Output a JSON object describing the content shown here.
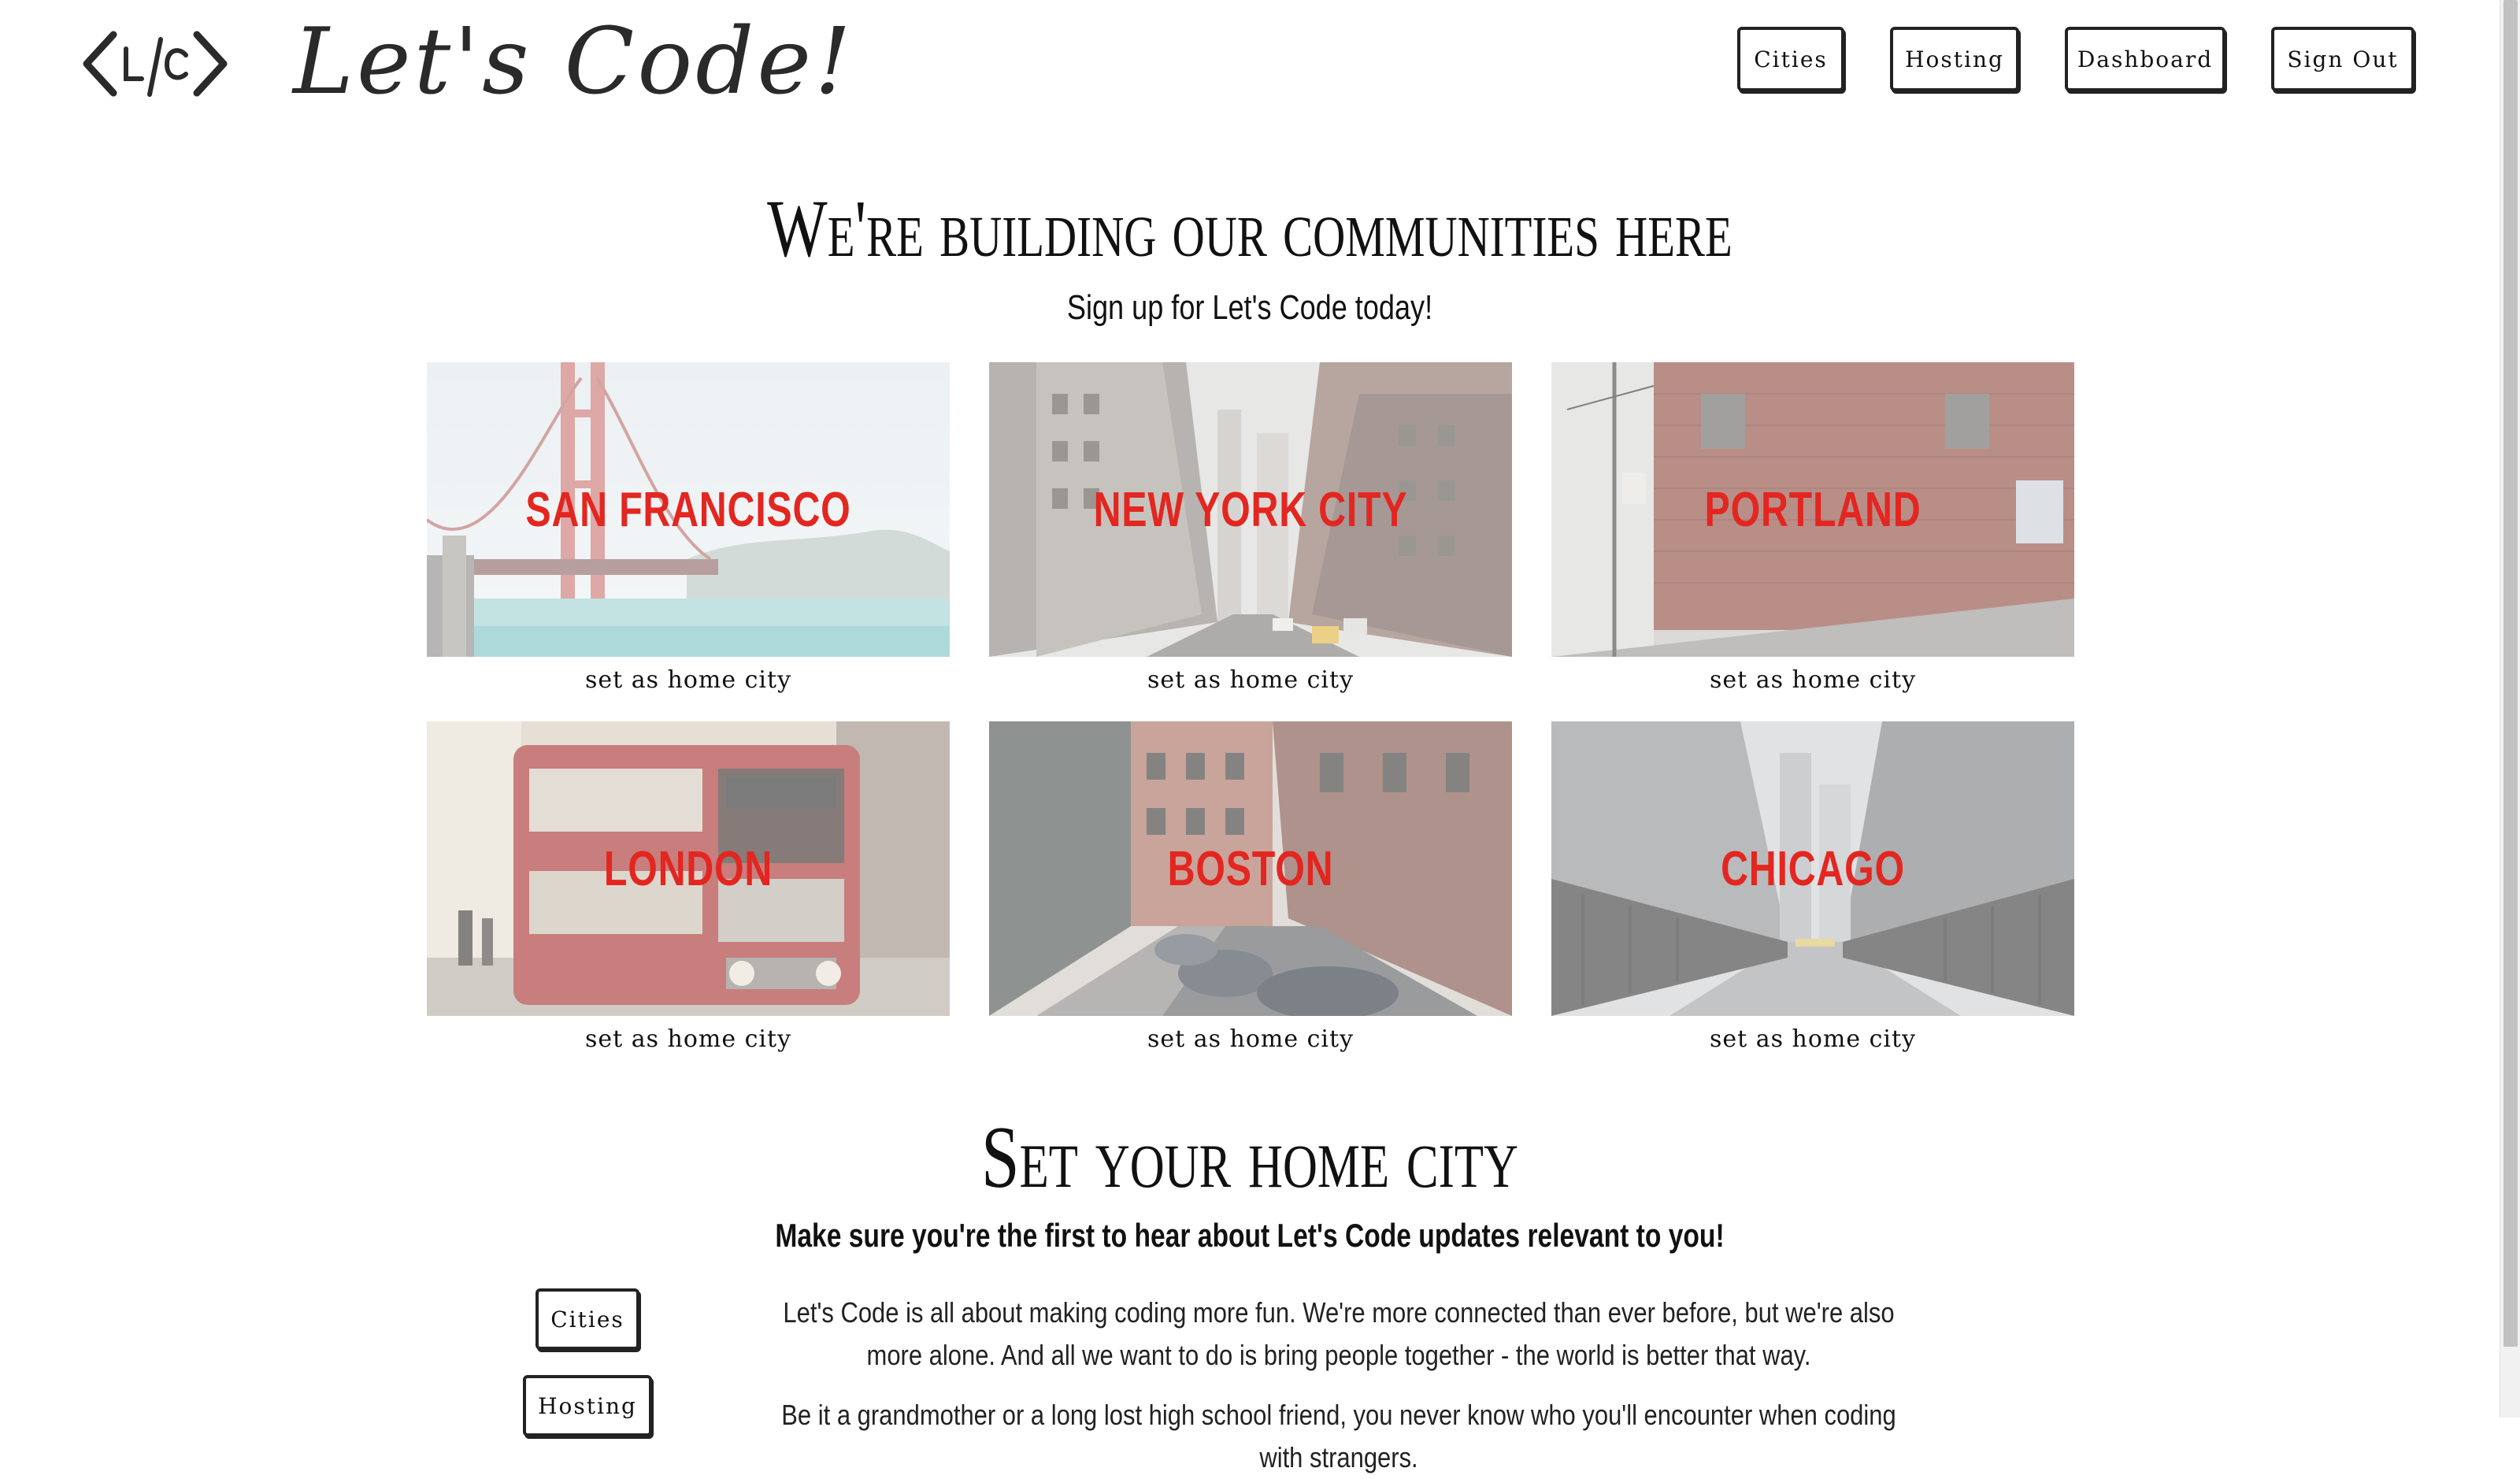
{
  "header": {
    "logo_text": "<L/C>",
    "brand": "Let's Code!",
    "nav": [
      {
        "label": "Cities"
      },
      {
        "label": "Hosting"
      },
      {
        "label": "Dashboard"
      },
      {
        "label": "Sign Out"
      }
    ]
  },
  "hero": {
    "title": "We're building our communities here",
    "subtitle": "Sign up for Let's Code today!"
  },
  "cities": [
    {
      "name": "SAN FRANCISCO",
      "action": "set as home city"
    },
    {
      "name": "NEW YORK CITY",
      "action": "set as home city"
    },
    {
      "name": "PORTLAND",
      "action": "set as home city"
    },
    {
      "name": "LONDON",
      "action": "set as home city"
    },
    {
      "name": "BOSTON",
      "action": "set as home city"
    },
    {
      "name": "CHICAGO",
      "action": "set as home city"
    }
  ],
  "home_section": {
    "title": "Set your home city",
    "subtitle": "Make sure you're the first to hear about Let's Code updates relevant to you!",
    "side_nav": [
      {
        "label": "Cities"
      },
      {
        "label": "Hosting"
      }
    ],
    "paragraphs": [
      "Let's Code is all about making coding more fun. We're more connected than ever before, but we're also more alone. And all we want to do is bring people together - the world is better that way.",
      "Be it a grandmother or a long lost high school friend, you never know who you'll encounter when coding with strangers."
    ]
  },
  "colors": {
    "city_label": "#e32620",
    "border": "#222222"
  }
}
